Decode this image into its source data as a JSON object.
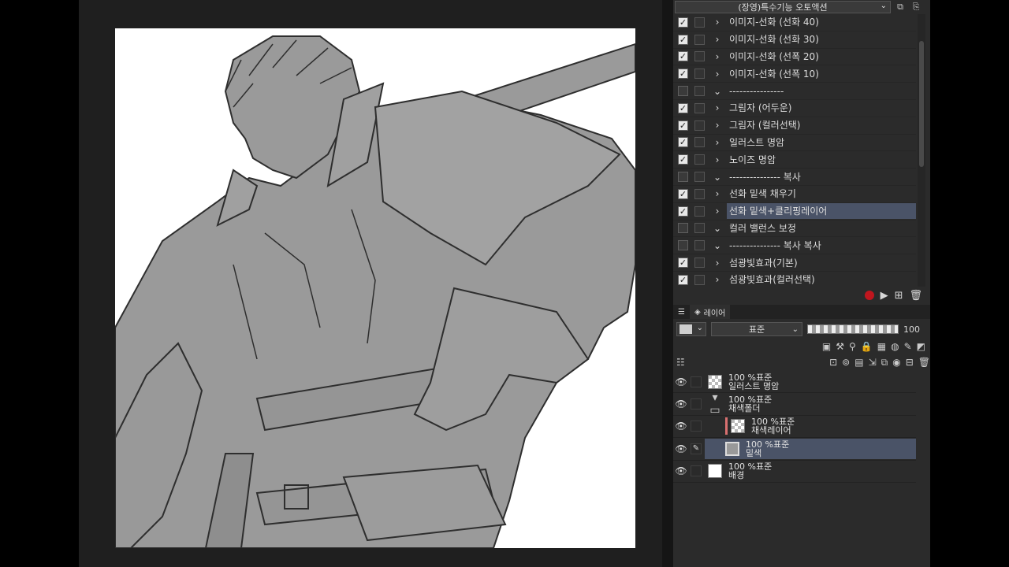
{
  "auto_action": {
    "set_name": "(장영)특수기능 오토액션",
    "items": [
      {
        "label": "이미지-선화 (선화 40)",
        "checked": true,
        "expand": ">",
        "selected": false
      },
      {
        "label": "이미지-선화 (선화 30)",
        "checked": true,
        "expand": ">",
        "selected": false
      },
      {
        "label": "이미지-선화 (선폭 20)",
        "checked": true,
        "expand": ">",
        "selected": false
      },
      {
        "label": "이미지-선화 (선폭 10)",
        "checked": true,
        "expand": ">",
        "selected": false
      },
      {
        "label": "----------------",
        "checked": false,
        "expand": "v",
        "selected": false
      },
      {
        "label": "그림자 (어두운)",
        "checked": true,
        "expand": ">",
        "selected": false
      },
      {
        "label": "그림자 (컬러선택)",
        "checked": true,
        "expand": ">",
        "selected": false
      },
      {
        "label": "일러스트 명암",
        "checked": true,
        "expand": ">",
        "selected": false
      },
      {
        "label": "노이즈 명암",
        "checked": true,
        "expand": ">",
        "selected": false
      },
      {
        "label": "--------------- 복사",
        "checked": false,
        "expand": "v",
        "selected": false
      },
      {
        "label": "선화 밑색 채우기",
        "checked": true,
        "expand": ">",
        "selected": false
      },
      {
        "label": "선화 밑색+클리핑레이어",
        "checked": true,
        "expand": ">",
        "selected": true
      },
      {
        "label": "컬러 밸런스 보정",
        "checked": false,
        "expand": "v",
        "selected": false
      },
      {
        "label": "--------------- 복사 복사",
        "checked": false,
        "expand": "v",
        "selected": false
      },
      {
        "label": "섬광빛효과(기본)",
        "checked": true,
        "expand": ">",
        "selected": false
      },
      {
        "label": "섬광빛효과(컬러선택)",
        "checked": true,
        "expand": ">",
        "selected": false
      }
    ]
  },
  "layer_panel": {
    "tab_label": "레이어",
    "blend_mode": "표준",
    "opacity": "100",
    "layers": [
      {
        "mode": "100 %표준",
        "name": "일러스트 명암",
        "kind": "raster",
        "selected": false,
        "indent": 0
      },
      {
        "mode": "100 %표준",
        "name": "채색폴더",
        "kind": "folder",
        "selected": false,
        "indent": 0
      },
      {
        "mode": "100 %표준",
        "name": "채색레이어",
        "kind": "clip",
        "selected": false,
        "indent": 1
      },
      {
        "mode": "100 %표준",
        "name": "밑색",
        "kind": "gray",
        "selected": true,
        "indent": 1
      },
      {
        "mode": "100 %표준",
        "name": "배경",
        "kind": "white",
        "selected": false,
        "indent": 0
      }
    ]
  },
  "colors": {
    "workspace": "#1f1f1f",
    "panel": "#2b2b2b",
    "selected": "#4a5367",
    "record": "#c0161e",
    "figure_fill": "#9a9a9a",
    "line": "#2e2e2e"
  }
}
